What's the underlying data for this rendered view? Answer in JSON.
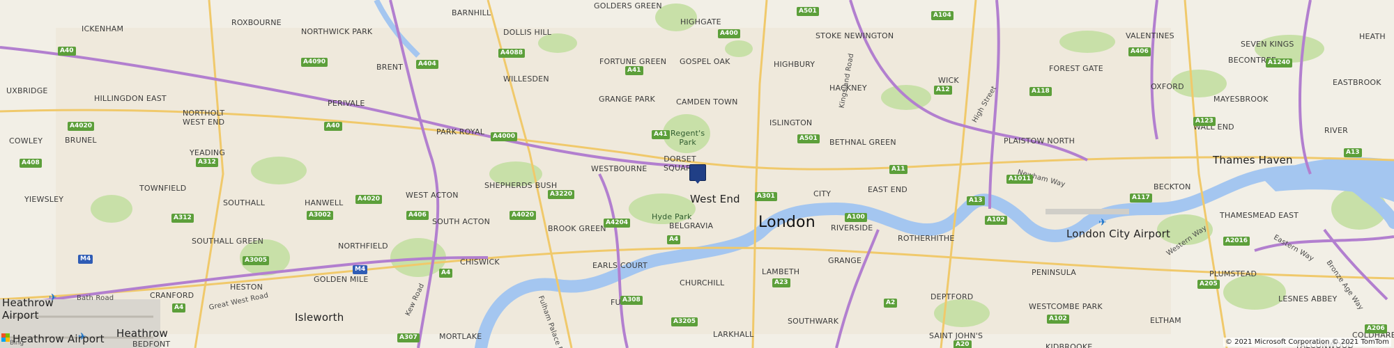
{
  "map": {
    "labels": [
      {
        "id": "golders-green",
        "text": "GOLDERS GREEN",
        "type": "district"
      },
      {
        "id": "barnhill",
        "text": "BARNHILL",
        "type": "district"
      },
      {
        "id": "roxbourne",
        "text": "ROXBOURNE",
        "type": "district"
      },
      {
        "id": "ickenham",
        "text": "ICKENHAM",
        "type": "district"
      },
      {
        "id": "northwick-park",
        "text": "NORTHWICK PARK",
        "type": "district"
      },
      {
        "id": "dollis-hill",
        "text": "DOLLIS HILL",
        "type": "district"
      },
      {
        "id": "highgate",
        "text": "HIGHGATE",
        "type": "district"
      },
      {
        "id": "stoke-newington",
        "text": "STOKE NEWINGTON",
        "type": "district"
      },
      {
        "id": "seven-kings",
        "text": "SEVEN KINGS",
        "type": "district"
      },
      {
        "id": "heath",
        "text": "HEATH",
        "type": "district"
      },
      {
        "id": "valentines",
        "text": "VALENTINES",
        "type": "district"
      },
      {
        "id": "brent",
        "text": "BRENT",
        "type": "district"
      },
      {
        "id": "fortune-green",
        "text": "FORTUNE GREEN",
        "type": "district"
      },
      {
        "id": "gospel-oak",
        "text": "GOSPEL OAK",
        "type": "district"
      },
      {
        "id": "highbury",
        "text": "HIGHBURY",
        "type": "district"
      },
      {
        "id": "forest-gate",
        "text": "FOREST GATE",
        "type": "district"
      },
      {
        "id": "becontree",
        "text": "BECONTREE",
        "type": "district"
      },
      {
        "id": "uxbridge",
        "text": "UXBRIDGE",
        "type": "district"
      },
      {
        "id": "hillingdon-east",
        "text": "HILLINGDON EAST",
        "type": "district"
      },
      {
        "id": "willesden",
        "text": "WILLESDEN",
        "type": "district"
      },
      {
        "id": "hackney",
        "text": "HACKNEY",
        "type": "district"
      },
      {
        "id": "wick",
        "text": "WICK",
        "type": "district"
      },
      {
        "id": "oxford",
        "text": "OXFORD",
        "type": "district"
      },
      {
        "id": "mayesbrook",
        "text": "MAYESBROOK",
        "type": "district"
      },
      {
        "id": "eastbrook",
        "text": "EASTBROOK",
        "type": "district"
      },
      {
        "id": "perivale",
        "text": "PERIVALE",
        "type": "district"
      },
      {
        "id": "grange-park",
        "text": "GRANGE PARK",
        "type": "district"
      },
      {
        "id": "camden-town",
        "text": "CAMDEN TOWN",
        "type": "district"
      },
      {
        "id": "northolt-west-end",
        "text": "NORTHOLT\nWEST END",
        "type": "district"
      },
      {
        "id": "islington",
        "text": "ISLINGTON",
        "type": "district"
      },
      {
        "id": "wall-end",
        "text": "WALL END",
        "type": "district"
      },
      {
        "id": "cowley",
        "text": "COWLEY",
        "type": "district"
      },
      {
        "id": "brunel",
        "text": "BRUNEL",
        "type": "district"
      },
      {
        "id": "park-royal",
        "text": "PARK ROYAL",
        "type": "district"
      },
      {
        "id": "regents-park",
        "text": "Regent's\nPark",
        "type": "park"
      },
      {
        "id": "bethnal-green",
        "text": "BETHNAL GREEN",
        "type": "district"
      },
      {
        "id": "plaistow-north",
        "text": "PLAISTOW NORTH",
        "type": "district"
      },
      {
        "id": "river",
        "text": "RIVER",
        "type": "district"
      },
      {
        "id": "yeading",
        "text": "YEADING",
        "type": "district"
      },
      {
        "id": "dorset-square",
        "text": "DORSET\nSQUARE",
        "type": "district"
      },
      {
        "id": "westbourne",
        "text": "WESTBOURNE",
        "type": "district"
      },
      {
        "id": "thames-haven",
        "text": "Thames Haven",
        "type": "place"
      },
      {
        "id": "townfield",
        "text": "TOWNFIELD",
        "type": "district"
      },
      {
        "id": "hanwell",
        "text": "HANWELL",
        "type": "district"
      },
      {
        "id": "shepherds-bush",
        "text": "SHEPHERDS BUSH",
        "type": "district"
      },
      {
        "id": "city",
        "text": "CITY",
        "type": "district"
      },
      {
        "id": "east-end",
        "text": "EAST END",
        "type": "district"
      },
      {
        "id": "beckton",
        "text": "BECKTON",
        "type": "district"
      },
      {
        "id": "west-end",
        "text": "West End",
        "type": "place"
      },
      {
        "id": "yiewsley",
        "text": "YIEWSLEY",
        "type": "district"
      },
      {
        "id": "southall",
        "text": "SOUTHALL",
        "type": "district"
      },
      {
        "id": "west-acton",
        "text": "WEST ACTON",
        "type": "district"
      },
      {
        "id": "hyde-park",
        "text": "Hyde Park",
        "type": "park"
      },
      {
        "id": "thamesmead-east",
        "text": "THAMESMEAD EAST",
        "type": "district"
      },
      {
        "id": "south-acton",
        "text": "SOUTH ACTON",
        "type": "district"
      },
      {
        "id": "belgravia",
        "text": "BELGRAVIA",
        "type": "district"
      },
      {
        "id": "london",
        "text": "London",
        "type": "city"
      },
      {
        "id": "riverside",
        "text": "RIVERSIDE",
        "type": "district"
      },
      {
        "id": "brook-green",
        "text": "BROOK GREEN",
        "type": "district"
      },
      {
        "id": "southall-green",
        "text": "SOUTHALL GREEN",
        "type": "district"
      },
      {
        "id": "rotherhithe",
        "text": "ROTHERHITHE",
        "type": "district"
      },
      {
        "id": "london-city-airport",
        "text": "London City Airport",
        "type": "place"
      },
      {
        "id": "northfield",
        "text": "NORTHFIELD",
        "type": "district"
      },
      {
        "id": "grange",
        "text": "GRANGE",
        "type": "district"
      },
      {
        "id": "chiswick",
        "text": "CHISWICK",
        "type": "district"
      },
      {
        "id": "earls-court",
        "text": "EARLS COURT",
        "type": "district"
      },
      {
        "id": "peninsula",
        "text": "PENINSULA",
        "type": "district"
      },
      {
        "id": "golden-mile",
        "text": "GOLDEN MILE",
        "type": "district"
      },
      {
        "id": "lambeth",
        "text": "LAMBETH",
        "type": "district"
      },
      {
        "id": "plumstead",
        "text": "PLUMSTEAD",
        "type": "district"
      },
      {
        "id": "heston",
        "text": "HESTON",
        "type": "district"
      },
      {
        "id": "churchill",
        "text": "CHURCHILL",
        "type": "district"
      },
      {
        "id": "heathrow-airport-1",
        "text": "Heathrow\nAirport",
        "type": "place"
      },
      {
        "id": "cranford",
        "text": "CRANFORD",
        "type": "district"
      },
      {
        "id": "fulham",
        "text": "FULHAM",
        "type": "district"
      },
      {
        "id": "deptford",
        "text": "DEPTFORD",
        "type": "district"
      },
      {
        "id": "lesnes-abbey",
        "text": "LESNES ABBEY",
        "type": "district"
      },
      {
        "id": "westcombe-park",
        "text": "WESTCOMBE PARK",
        "type": "district"
      },
      {
        "id": "isleworth",
        "text": "Isleworth",
        "type": "place"
      },
      {
        "id": "southwark",
        "text": "SOUTHWARK",
        "type": "district"
      },
      {
        "id": "eltham",
        "text": "ELTHAM",
        "type": "district"
      },
      {
        "id": "heathrow",
        "text": "Heathrow",
        "type": "place"
      },
      {
        "id": "heathrow-airport-2",
        "text": "Heathrow Airport",
        "type": "place"
      },
      {
        "id": "mortlake",
        "text": "MORTLAKE",
        "type": "district"
      },
      {
        "id": "larkhall",
        "text": "LARKHALL",
        "type": "district"
      },
      {
        "id": "saint-johns",
        "text": "SAINT JOHN'S",
        "type": "district"
      },
      {
        "id": "kidbrooke",
        "text": "KIDBROOKE",
        "type": "district"
      },
      {
        "id": "falconwood",
        "text": "FALCONWOOD",
        "type": "district"
      },
      {
        "id": "coldharbour",
        "text": "COLDHARBOUR",
        "type": "district"
      },
      {
        "id": "bedfont",
        "text": "BEDFONT",
        "type": "district"
      }
    ],
    "streets": [
      {
        "id": "kingsland-road",
        "text": "Kingsland Road"
      },
      {
        "id": "high-street",
        "text": "High Street"
      },
      {
        "id": "newham-way",
        "text": "Newham Way"
      },
      {
        "id": "bath-road",
        "text": "Bath Road"
      },
      {
        "id": "great-west-road",
        "text": "Great West Road"
      },
      {
        "id": "kew-road",
        "text": "Kew Road"
      },
      {
        "id": "fulham-palace-road",
        "text": "Fulham Palace Road"
      },
      {
        "id": "western-way",
        "text": "Western Way"
      },
      {
        "id": "eastern-way",
        "text": "Eastern Way"
      },
      {
        "id": "bronze-age-way",
        "text": "Bronze Age Way"
      }
    ],
    "shields": [
      {
        "id": "a501-n",
        "text": "A501",
        "kind": "a"
      },
      {
        "id": "a104",
        "text": "A104",
        "kind": "a"
      },
      {
        "id": "a400",
        "text": "A400",
        "kind": "a"
      },
      {
        "id": "a4088",
        "text": "A4088",
        "kind": "a"
      },
      {
        "id": "a406",
        "text": "A406",
        "kind": "a"
      },
      {
        "id": "a40-w",
        "text": "A40",
        "kind": "a"
      },
      {
        "id": "a4090",
        "text": "A4090",
        "kind": "a"
      },
      {
        "id": "a404",
        "text": "A404",
        "kind": "a"
      },
      {
        "id": "a41-n",
        "text": "A41",
        "kind": "a"
      },
      {
        "id": "a1240",
        "text": "A1240",
        "kind": "a"
      },
      {
        "id": "a12",
        "text": "A12",
        "kind": "a"
      },
      {
        "id": "a118",
        "text": "A118",
        "kind": "a"
      },
      {
        "id": "a4020-w",
        "text": "A4020",
        "kind": "a"
      },
      {
        "id": "a40-c",
        "text": "A40",
        "kind": "a"
      },
      {
        "id": "a123",
        "text": "A123",
        "kind": "a"
      },
      {
        "id": "a4000",
        "text": "A4000",
        "kind": "a"
      },
      {
        "id": "a41-c",
        "text": "A41",
        "kind": "a"
      },
      {
        "id": "a501-c",
        "text": "A501",
        "kind": "a"
      },
      {
        "id": "a13-e",
        "text": "A13",
        "kind": "a"
      },
      {
        "id": "a312-n",
        "text": "A312",
        "kind": "a"
      },
      {
        "id": "a408",
        "text": "A408",
        "kind": "a"
      },
      {
        "id": "a11",
        "text": "A11",
        "kind": "a"
      },
      {
        "id": "a1011",
        "text": "A1011",
        "kind": "a"
      },
      {
        "id": "a3220",
        "text": "A3220",
        "kind": "a"
      },
      {
        "id": "a301",
        "text": "A301",
        "kind": "a"
      },
      {
        "id": "a13-c",
        "text": "A13",
        "kind": "a"
      },
      {
        "id": "a117",
        "text": "A117",
        "kind": "a"
      },
      {
        "id": "a4020-c",
        "text": "A4020",
        "kind": "a"
      },
      {
        "id": "a312-s",
        "text": "A312",
        "kind": "a"
      },
      {
        "id": "a3002",
        "text": "A3002",
        "kind": "a"
      },
      {
        "id": "a406-s",
        "text": "A406",
        "kind": "a"
      },
      {
        "id": "a4020-e",
        "text": "A4020",
        "kind": "a"
      },
      {
        "id": "a4204",
        "text": "A4204",
        "kind": "a"
      },
      {
        "id": "a100",
        "text": "A100",
        "kind": "a"
      },
      {
        "id": "a102-n",
        "text": "A102",
        "kind": "a"
      },
      {
        "id": "a2016",
        "text": "A2016",
        "kind": "a"
      },
      {
        "id": "a4-c",
        "text": "A4",
        "kind": "a"
      },
      {
        "id": "a3005",
        "text": "A3005",
        "kind": "a"
      },
      {
        "id": "m4-a",
        "text": "M4",
        "kind": "m"
      },
      {
        "id": "m4-b",
        "text": "M4",
        "kind": "m"
      },
      {
        "id": "a4-w",
        "text": "A4",
        "kind": "a"
      },
      {
        "id": "a23",
        "text": "A23",
        "kind": "a"
      },
      {
        "id": "a205",
        "text": "A205",
        "kind": "a"
      },
      {
        "id": "a308",
        "text": "A308",
        "kind": "a"
      },
      {
        "id": "a2",
        "text": "A2",
        "kind": "a"
      },
      {
        "id": "a4-sw",
        "text": "A4",
        "kind": "a"
      },
      {
        "id": "a3205",
        "text": "A3205",
        "kind": "a"
      },
      {
        "id": "a102-s",
        "text": "A102",
        "kind": "a"
      },
      {
        "id": "a307",
        "text": "A307",
        "kind": "a"
      },
      {
        "id": "a20",
        "text": "A20",
        "kind": "a"
      },
      {
        "id": "a206",
        "text": "A206",
        "kind": "a"
      }
    ],
    "icons": {
      "pin": "location-pin-icon",
      "airport": "airplane-icon",
      "logo": "bing-logo-icon"
    },
    "branding": {
      "name": "Bing"
    },
    "copyright": "© 2021 Microsoft Corporation © 2021 TomTom",
    "colors": {
      "land": "#f2efe6",
      "water": "#a4c6f0",
      "park": "#c8e0a8",
      "motorway": "#b27fcf",
      "major_road": "#f0c96b",
      "pin": "#203f86",
      "shield_a": "#5c9f3a",
      "shield_m": "#2f5cb5"
    }
  }
}
